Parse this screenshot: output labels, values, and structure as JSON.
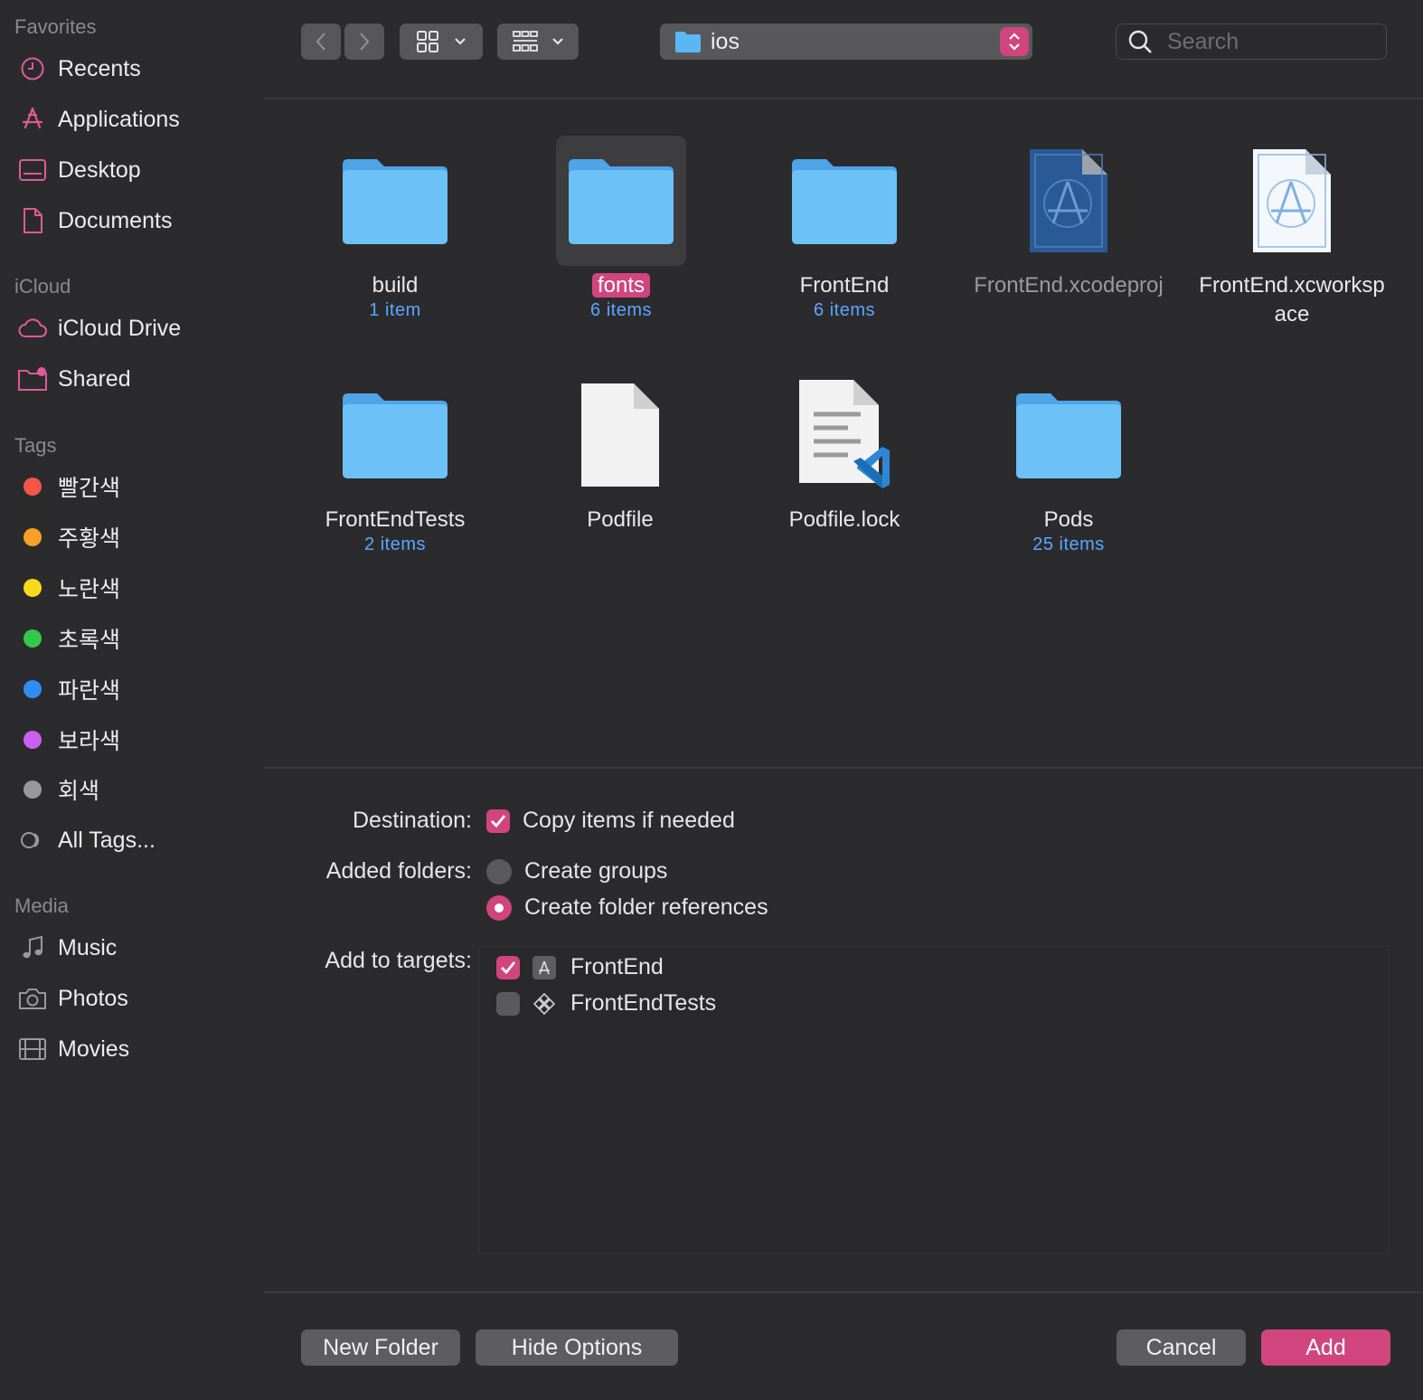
{
  "sidebar": {
    "favorites_title": "Favorites",
    "favorites": [
      {
        "label": "Recents",
        "icon": "clock-icon"
      },
      {
        "label": "Applications",
        "icon": "applications-icon"
      },
      {
        "label": "Desktop",
        "icon": "desktop-icon"
      },
      {
        "label": "Documents",
        "icon": "document-icon"
      }
    ],
    "icloud_title": "iCloud",
    "icloud": [
      {
        "label": "iCloud Drive",
        "icon": "cloud-icon"
      },
      {
        "label": "Shared",
        "icon": "shared-folder-icon"
      }
    ],
    "tags_title": "Tags",
    "tags": [
      {
        "label": "빨간색",
        "color": "#f4564a"
      },
      {
        "label": "주황색",
        "color": "#f7a126"
      },
      {
        "label": "노란색",
        "color": "#f9d81c"
      },
      {
        "label": "초록색",
        "color": "#33c84a"
      },
      {
        "label": "파란색",
        "color": "#2f8ef6"
      },
      {
        "label": "보라색",
        "color": "#cc5ff0"
      },
      {
        "label": "회색",
        "color": "#98989b"
      }
    ],
    "all_tags": "All Tags...",
    "media_title": "Media",
    "media": [
      {
        "label": "Music",
        "icon": "music-note-icon"
      },
      {
        "label": "Photos",
        "icon": "camera-icon"
      },
      {
        "label": "Movies",
        "icon": "film-icon"
      }
    ]
  },
  "toolbar": {
    "location": "ios",
    "search_placeholder": "Search"
  },
  "files": [
    {
      "name": "build",
      "count": "1 item",
      "type": "folder"
    },
    {
      "name": "fonts",
      "count": "6 items",
      "type": "folder",
      "selected": true
    },
    {
      "name": "FrontEnd",
      "count": "6 items",
      "type": "folder"
    },
    {
      "name": "FrontEnd.xcodeproj",
      "count": "",
      "type": "xcodeproj"
    },
    {
      "name": "FrontEnd.xcworkspace",
      "count": "",
      "type": "xcworkspace"
    },
    {
      "name": "FrontEndTests",
      "count": "2 items",
      "type": "folder"
    },
    {
      "name": "Podfile",
      "count": "",
      "type": "file"
    },
    {
      "name": "Podfile.lock",
      "count": "",
      "type": "vscode-file"
    },
    {
      "name": "Pods",
      "count": "25 items",
      "type": "folder"
    }
  ],
  "options": {
    "destination_label": "Destination:",
    "copy_items": "Copy items if needed",
    "added_folders_label": "Added folders:",
    "create_groups": "Create groups",
    "create_folder_refs": "Create folder references",
    "add_to_targets_label": "Add to targets:",
    "targets": [
      {
        "name": "FrontEnd",
        "checked": true
      },
      {
        "name": "FrontEndTests",
        "checked": false
      }
    ]
  },
  "buttons": {
    "new_folder": "New Folder",
    "hide_options": "Hide Options",
    "cancel": "Cancel",
    "add": "Add"
  },
  "colors": {
    "accent": "#d0457e",
    "folder": "#5ab6f4",
    "link": "#5aa7ff"
  }
}
